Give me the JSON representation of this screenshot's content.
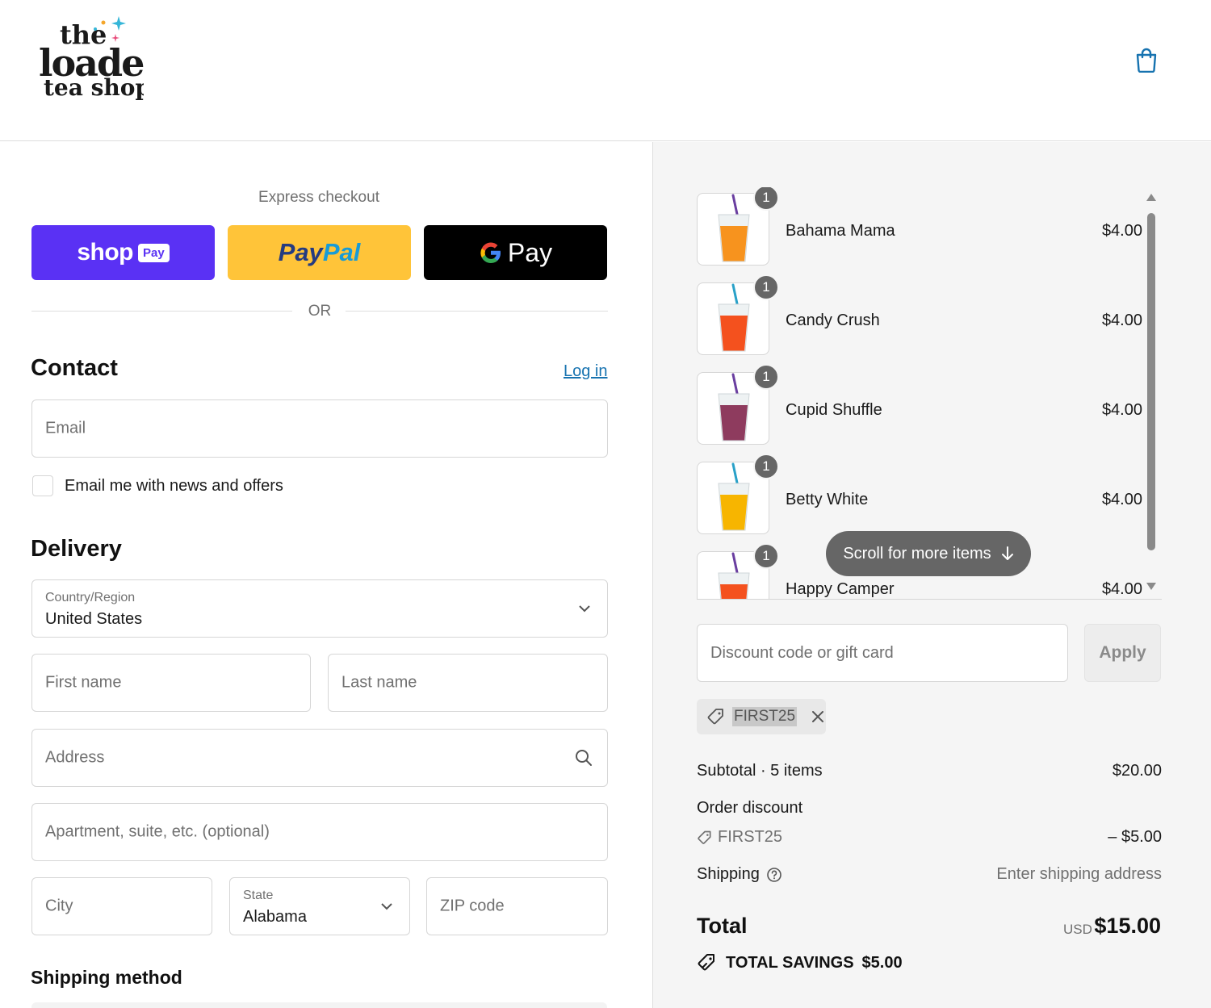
{
  "brand": {
    "logo_line1": "the",
    "logo_line2": "loaded",
    "logo_line3": "tea shop"
  },
  "express": {
    "title": "Express checkout",
    "shop_pay": "shop",
    "shop_pay_pill": "Pay",
    "paypal_1": "Pay",
    "paypal_2": "Pal",
    "gpay_g": "G",
    "gpay_word": "Pay",
    "or": "OR"
  },
  "contact": {
    "heading": "Contact",
    "login": "Log in",
    "email_placeholder": "Email",
    "newsletter_label": "Email me with news and offers"
  },
  "delivery": {
    "heading": "Delivery",
    "country_label": "Country/Region",
    "country_value": "United States",
    "first_name": "First name",
    "last_name": "Last name",
    "address": "Address",
    "apartment": "Apartment, suite, etc. (optional)",
    "city": "City",
    "state_label": "State",
    "state_value": "Alabama",
    "zip": "ZIP code"
  },
  "shipping_method": {
    "heading": "Shipping method"
  },
  "cart": {
    "items": [
      {
        "name": "Bahama Mama",
        "price": "$4.00",
        "qty": "1",
        "drink": "#f7931e"
      },
      {
        "name": "Candy Crush",
        "price": "$4.00",
        "qty": "1",
        "drink": "#f4511e"
      },
      {
        "name": "Cupid Shuffle",
        "price": "$4.00",
        "qty": "1",
        "drink": "#8e3b5e"
      },
      {
        "name": "Betty White",
        "price": "$4.00",
        "qty": "1",
        "drink": "#f7b500"
      },
      {
        "name": "Happy Camper",
        "price": "$4.00",
        "qty": "1",
        "drink": "#f4511e"
      }
    ],
    "scroll_hint": "Scroll for more items"
  },
  "discount": {
    "placeholder": "Discount code or gift card",
    "apply": "Apply",
    "applied_code": "FIRST25"
  },
  "summary": {
    "subtotal_label": "Subtotal · 5 items",
    "subtotal_value": "$20.00",
    "order_discount_label": "Order discount",
    "discount_code": "FIRST25",
    "discount_value": "– $5.00",
    "shipping_label": "Shipping",
    "shipping_value": "Enter shipping address",
    "total_label": "Total",
    "currency": "USD",
    "total_value": "$15.00",
    "savings_label": "TOTAL SAVINGS",
    "savings_value": "$5.00"
  },
  "colors": {
    "shop_pay": "#5a31f4",
    "paypal": "#ffc439",
    "gpay": "#000000",
    "link": "#1773b0",
    "accent_icon": "#1773b0"
  }
}
